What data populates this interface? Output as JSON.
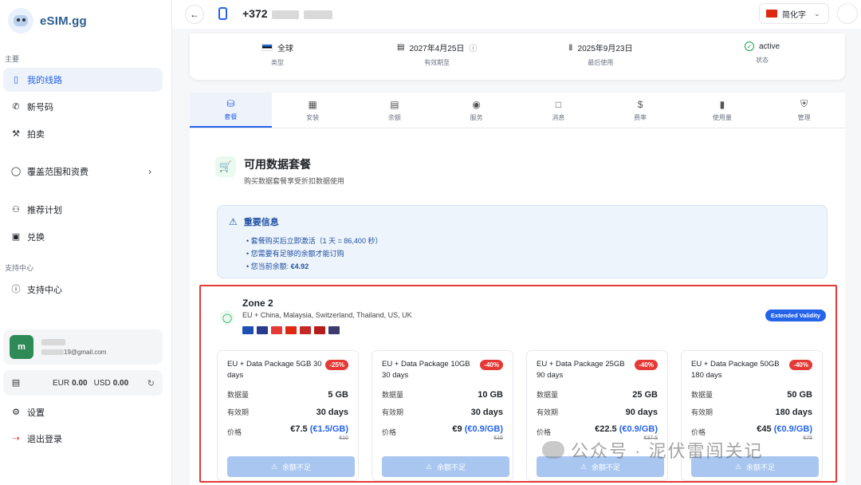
{
  "brand": {
    "name": "eSIM.gg"
  },
  "sidebar": {
    "section_main": "主要",
    "items": [
      {
        "label": "我的线路",
        "icon": "phone-icon",
        "active": true
      },
      {
        "label": "新号码",
        "icon": "phone-call-icon"
      },
      {
        "label": "拍卖",
        "icon": "gavel-icon"
      },
      {
        "label": "覆盖范围和资费",
        "icon": "globe-icon",
        "chevron": true
      },
      {
        "label": "推荐计划",
        "icon": "users-icon"
      },
      {
        "label": "兑换",
        "icon": "gift-icon"
      }
    ],
    "section_support": "支持中心",
    "support_item": {
      "label": "支持中心",
      "icon": "help-icon"
    },
    "user": {
      "initial": "m",
      "email_suffix": "19@gmail.com"
    },
    "balance": {
      "eur_label": "EUR",
      "eur_value": "0.00",
      "usd_label": "USD",
      "usd_value": "0.00"
    },
    "settings": "设置",
    "logout": "退出登录"
  },
  "header": {
    "phone_prefix": "+372",
    "language": "简化字"
  },
  "info": {
    "type_value": "全球",
    "type_label": "类型",
    "expiry_value": "2027年4月25日",
    "expiry_label": "有效期至",
    "last_used_value": "2025年9月23日",
    "last_used_label": "最后使用",
    "status_value": "active",
    "status_label": "状态"
  },
  "tabs": [
    {
      "label": "套餐",
      "icon": "database-icon",
      "active": true
    },
    {
      "label": "安装",
      "icon": "qr-icon"
    },
    {
      "label": "余额",
      "icon": "wallet-icon"
    },
    {
      "label": "服务",
      "icon": "service-icon"
    },
    {
      "label": "消息",
      "icon": "message-icon"
    },
    {
      "label": "费率",
      "icon": "dollar-icon"
    },
    {
      "label": "使用量",
      "icon": "chart-icon"
    },
    {
      "label": "管理",
      "icon": "shield-icon"
    }
  ],
  "packages": {
    "title": "可用数据套餐",
    "subtitle": "购买数据套餐享受折扣数据使用",
    "notice": {
      "title": "重要信息",
      "items": [
        "套餐购买后立即激活（1 天 = 86,400 秒）",
        "您需要有足够的余额才能订购"
      ],
      "balance_prefix": "您当前余额: ",
      "balance_value": "€4.92"
    }
  },
  "zone": {
    "title": "Zone 2",
    "countries": "EU + China, Malaysia, Switzerland, Thailand, US, UK",
    "badge": "Extended Validity",
    "flag_colors": [
      "#1e4fb3",
      "#2a3a8f",
      "#e53935",
      "#de2910",
      "#c62828",
      "#b71c1c",
      "#3c3b6e"
    ],
    "labels": {
      "data": "数据量",
      "validity": "有效期",
      "price": "价格",
      "button": "余额不足"
    },
    "plans": [
      {
        "name": "EU + Data Package 5GB 30 days",
        "discount": "-25%",
        "data": "5 GB",
        "validity": "30 days",
        "price": "€7.5",
        "per_gb": "(€1.5/GB)",
        "old_price": "€10"
      },
      {
        "name": "EU + Data Package 10GB 30 days",
        "discount": "-40%",
        "data": "10 GB",
        "validity": "30 days",
        "price": "€9",
        "per_gb": "(€0.9/GB)",
        "old_price": "€15"
      },
      {
        "name": "EU + Data Package 25GB 90 days",
        "discount": "-40%",
        "data": "25 GB",
        "validity": "90 days",
        "price": "€22.5",
        "per_gb": "(€0.9/GB)",
        "old_price": "€37.5"
      },
      {
        "name": "EU + Data Package 50GB 180 days",
        "discount": "-40%",
        "data": "50 GB",
        "validity": "180 days",
        "price": "€45",
        "per_gb": "(€0.9/GB)",
        "old_price": "€75"
      }
    ]
  },
  "watermark": "公众号 · 泥伏雷闯关记"
}
